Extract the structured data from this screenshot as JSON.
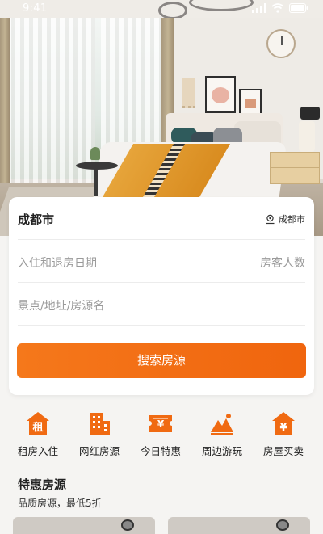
{
  "status_bar": {
    "time": "9:41"
  },
  "search": {
    "city": "成都市",
    "locate_label": "成都市",
    "date_placeholder": "入住和退房日期",
    "guests_placeholder": "房客人数",
    "keyword_placeholder": "景点/地址/房源名",
    "button_label": "搜索房源"
  },
  "categories": [
    {
      "label": "租房入住",
      "icon": "rent-icon",
      "glyph": "租"
    },
    {
      "label": "网红房源",
      "icon": "building-icon"
    },
    {
      "label": "今日特惠",
      "icon": "coupon-icon",
      "glyph": "¥"
    },
    {
      "label": "周边游玩",
      "icon": "mountain-icon"
    },
    {
      "label": "房屋买卖",
      "icon": "house-yuan-icon",
      "glyph": "¥"
    }
  ],
  "section": {
    "title": "特惠房源",
    "subtitle": "品质房源，最低5折"
  },
  "colors": {
    "accent": "#f06a12",
    "accent_light": "#f5781b"
  }
}
